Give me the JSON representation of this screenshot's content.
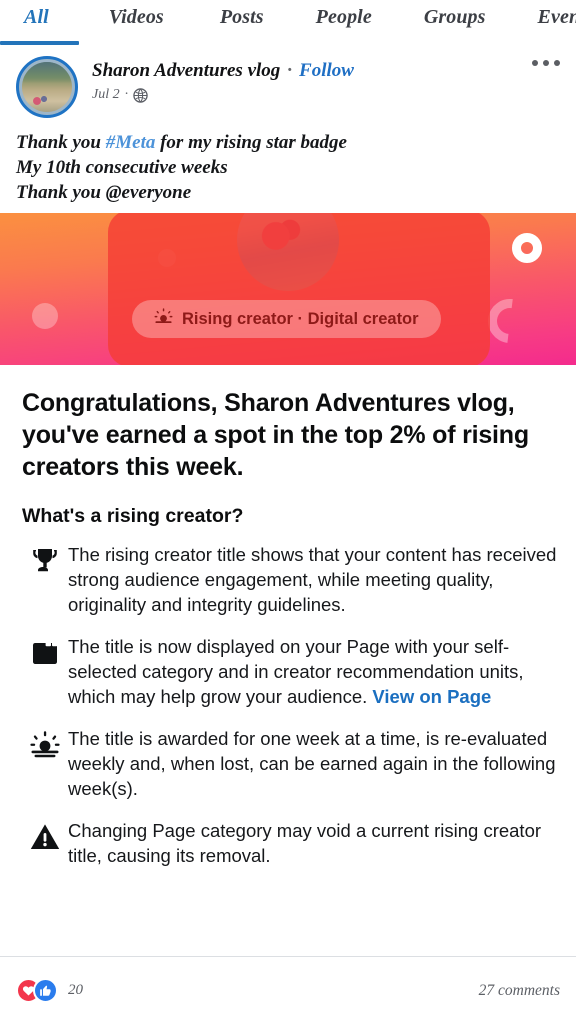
{
  "tabs": {
    "items": [
      {
        "label": "All",
        "active": true
      },
      {
        "label": "Videos",
        "active": false
      },
      {
        "label": "Posts",
        "active": false
      },
      {
        "label": "People",
        "active": false
      },
      {
        "label": "Groups",
        "active": false
      },
      {
        "label": "Events",
        "active": false
      }
    ],
    "active_color": "#2374ba"
  },
  "post": {
    "author": "Sharon Adventures vlog",
    "separator": "·",
    "follow_label": "Follow",
    "date": "Jul 2",
    "meta_separator": "·",
    "audience_icon": "globe-icon",
    "more_icon": "more-options-icon",
    "text": {
      "line1_before": "Thank you ",
      "line1_hashtag": "#Meta",
      "line1_after": " for my rising star badge",
      "line2": "My 10th consecutive weeks",
      "line3": "Thank you @everyone"
    }
  },
  "banner": {
    "gradient_from": "#fb9040",
    "gradient_to": "#f42b8d",
    "overlay_color": "#f53c34",
    "badge_icon": "sunrise-icon",
    "badge_label": "Rising creator · Digital creator"
  },
  "card": {
    "congrats": "Congratulations, Sharon Adventures vlog, you've earned a spot in the top 2% of rising creators this week.",
    "subhead": "What's a rising creator?",
    "items": [
      {
        "icon": "trophy-icon",
        "text": "The rising creator title shows that your content has received strong audience engagement, while meeting quality, originality and integrity guidelines."
      },
      {
        "icon": "page-icon",
        "text": "The title is now displayed on your Page with your self-selected category and in creator recommendation units, which may help grow your audience. ",
        "link": "View on Page"
      },
      {
        "icon": "sunrise-icon",
        "text": "The title is awarded for one week at a time, is re-evaluated weekly and, when lost, can be earned again in the following week(s)."
      },
      {
        "icon": "warning-icon",
        "text": "Changing Page category may void a current rising creator title, causing its removal."
      }
    ],
    "link_color": "#1b6fc0"
  },
  "footer": {
    "reaction_icons": [
      "love-reaction-icon",
      "like-reaction-icon"
    ],
    "reaction_count": "20",
    "comments": "27 comments"
  }
}
